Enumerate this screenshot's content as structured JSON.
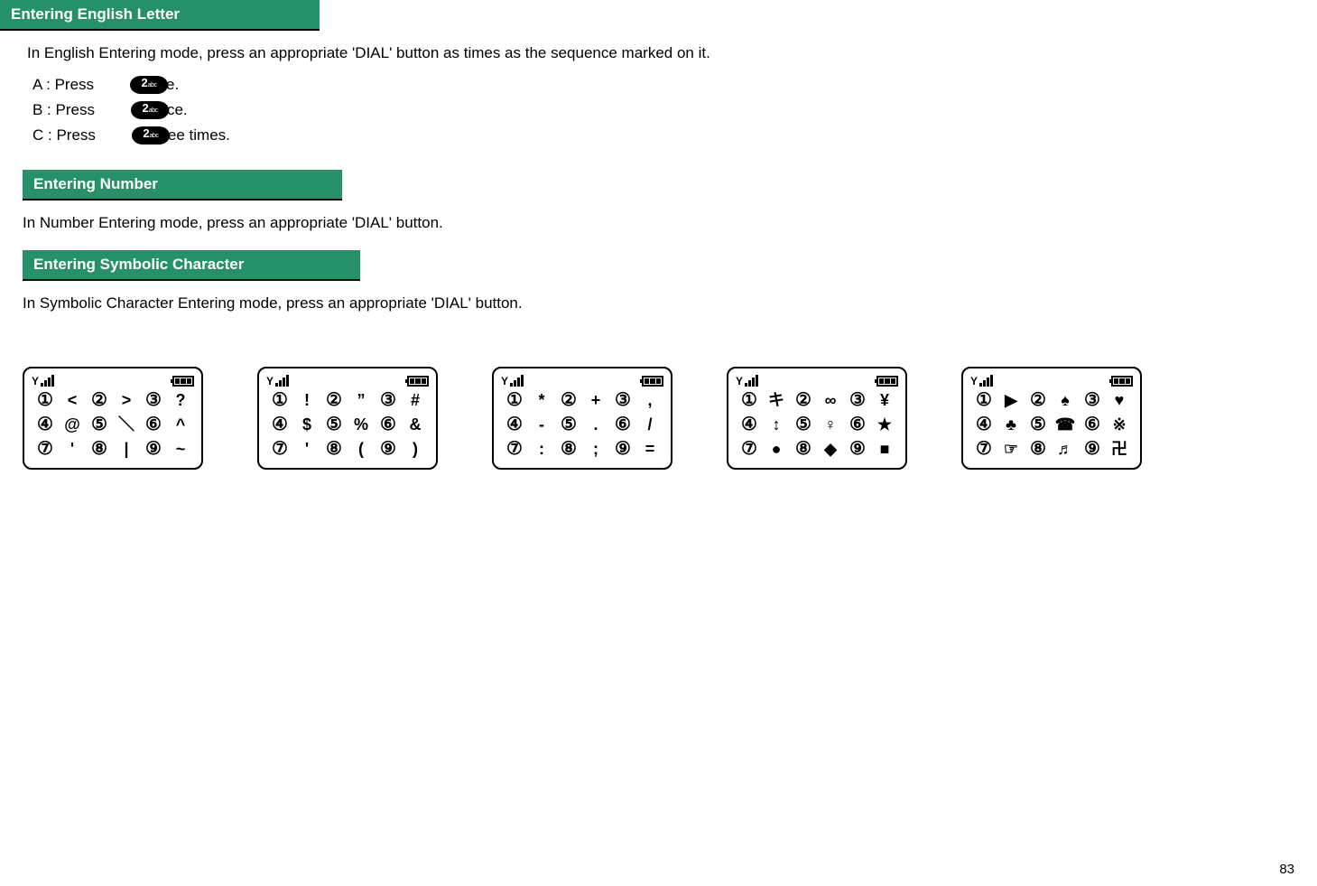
{
  "sections": {
    "english": {
      "header": "Entering English Letter",
      "intro": "In English Entering mode, press an appropriate 'DIAL' button as times as the sequence marked on it.",
      "rows": [
        {
          "label": "A : Press",
          "key_main": "2",
          "key_sub": "abc",
          "suffix": "e."
        },
        {
          "label": "B : Press",
          "key_main": "2",
          "key_sub": "abc",
          "suffix": "ce."
        },
        {
          "label": "C : Press",
          "key_main": "2",
          "key_sub": "abc",
          "suffix": "ee times."
        }
      ]
    },
    "number": {
      "header": "Entering Number",
      "intro": "In Number Entering mode, press an appropriate 'DIAL' button."
    },
    "symbolic": {
      "header": "Entering Symbolic Character",
      "intro": "In Symbolic Character Entering mode, press an appropriate 'DIAL' button."
    }
  },
  "screens": [
    {
      "cells": [
        "①",
        "<",
        "②",
        ">",
        "③",
        "?",
        "④",
        "@",
        "⑤",
        "＼",
        "⑥",
        "^",
        "⑦",
        "'",
        "⑧",
        "|",
        "⑨",
        "~"
      ]
    },
    {
      "cells": [
        "①",
        "!",
        "②",
        "”",
        "③",
        "#",
        "④",
        "$",
        "⑤",
        "%",
        "⑥",
        "&",
        "⑦",
        "'",
        "⑧",
        "(",
        "⑨",
        ")"
      ]
    },
    {
      "cells": [
        "①",
        "*",
        "②",
        "+",
        "③",
        ",",
        "④",
        "-",
        "⑤",
        ".",
        "⑥",
        "/",
        "⑦",
        ":",
        "⑧",
        ";",
        "⑨",
        "="
      ]
    },
    {
      "cells": [
        "①",
        "キ",
        "②",
        "∞",
        "③",
        "¥",
        "④",
        "↕",
        "⑤",
        "♀",
        "⑥",
        "★",
        "⑦",
        "●",
        "⑧",
        "◆",
        "⑨",
        "■"
      ]
    },
    {
      "cells": [
        "①",
        "▶",
        "②",
        "♠",
        "③",
        "♥",
        "④",
        "♣",
        "⑤",
        "☎",
        "⑥",
        "※",
        "⑦",
        "☞",
        "⑧",
        "♬",
        "⑨",
        "卍"
      ]
    }
  ],
  "page_number": "83"
}
